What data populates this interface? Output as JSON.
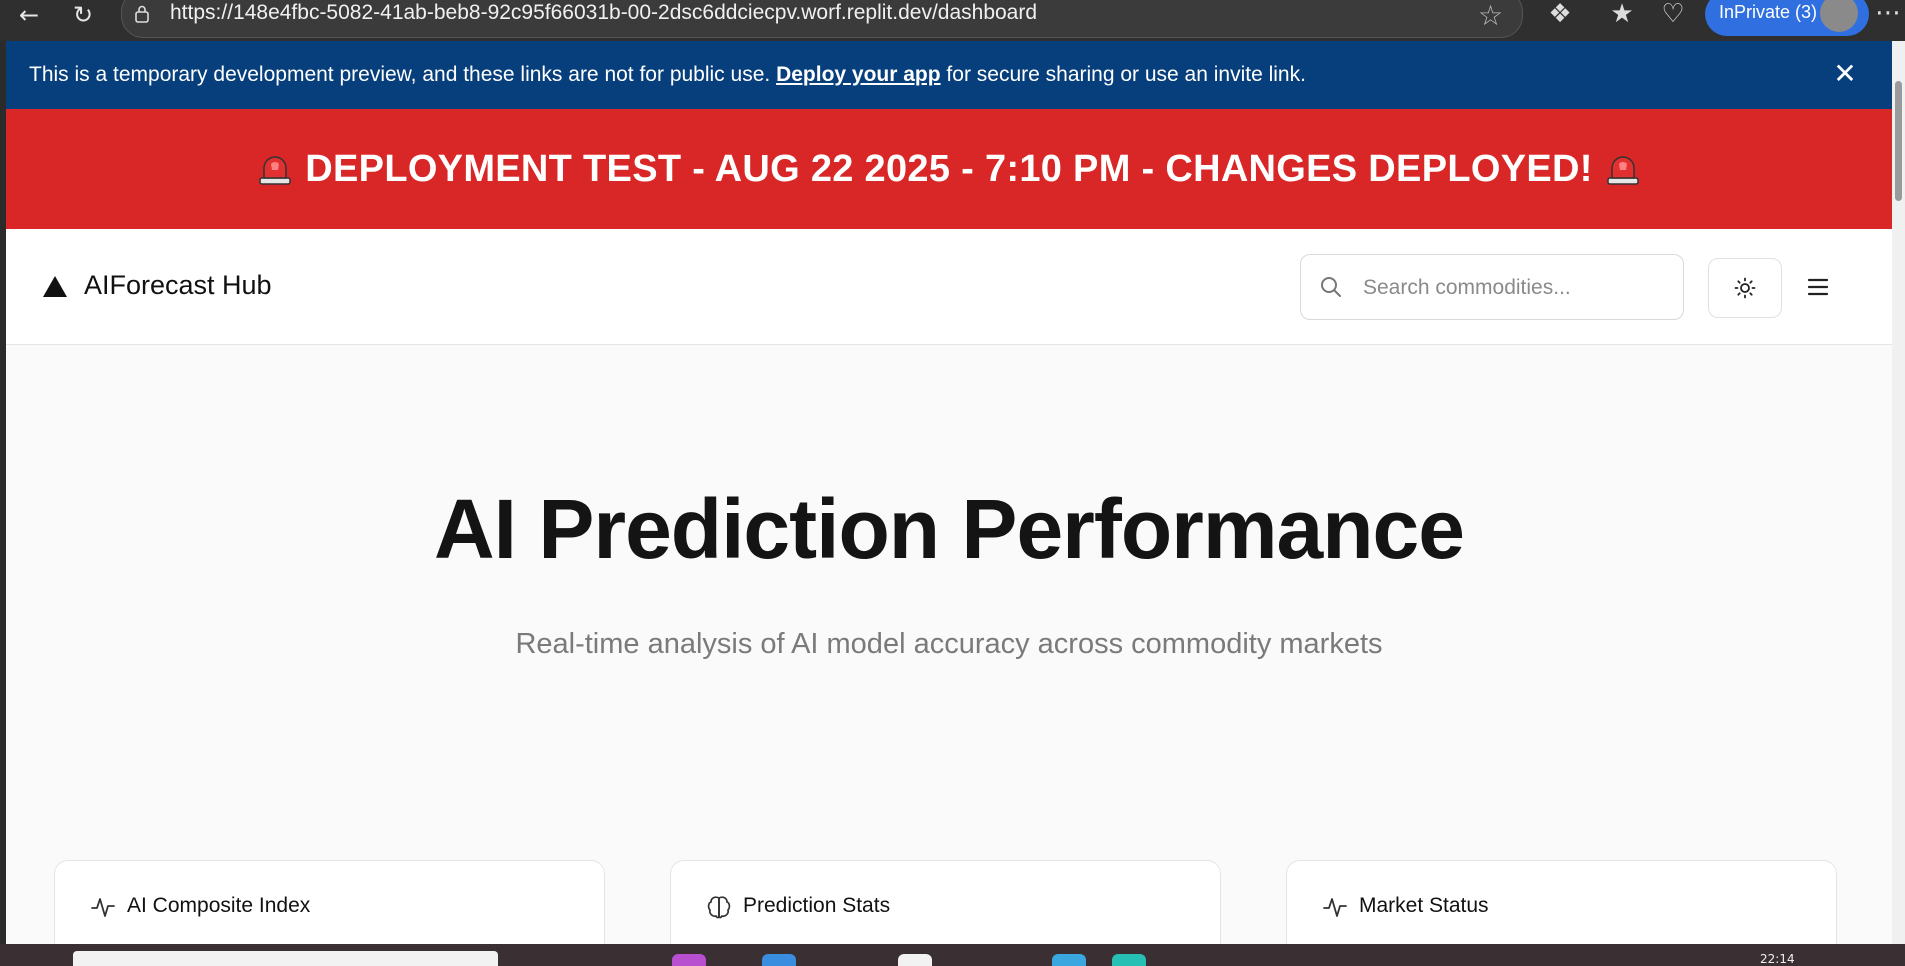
{
  "browser": {
    "url": "https://148e4fbc-5082-41ab-beb8-92c95f66031b-00-2dsc6ddciecpv.worf.replit.dev/dashboard",
    "profile_label": "InPrivate (3)",
    "icons": [
      "back-icon",
      "refresh-icon",
      "lock-icon",
      "star-icon",
      "extensions-icon",
      "favorites-icon",
      "health-icon",
      "more-icon"
    ]
  },
  "preview_banner": {
    "text_before": "This is a temporary development preview, and these links are not for public use. ",
    "link_text": "Deploy your app",
    "text_after": " for secure sharing or use an invite link."
  },
  "deploy_banner": {
    "text": "DEPLOYMENT TEST - AUG 22 2025 - 7:10 PM - CHANGES DEPLOYED!",
    "icon": "siren-icon"
  },
  "header": {
    "logo_text": "AIForecast Hub",
    "search_placeholder": "Search commodities..."
  },
  "hero": {
    "title": "AI Prediction Performance",
    "subtitle": "Real-time analysis of AI model accuracy across commodity markets"
  },
  "cards": [
    {
      "title": "AI Composite Index",
      "icon": "activity-icon"
    },
    {
      "title": "Prediction Stats",
      "icon": "brain-icon"
    },
    {
      "title": "Market Status",
      "icon": "activity-icon"
    }
  ],
  "taskbar": {
    "clock": "22:14"
  },
  "colors": {
    "preview_banner_bg": "#073f7d",
    "deploy_banner_bg": "#d92626",
    "profile_accent": "#2f6fe0"
  }
}
